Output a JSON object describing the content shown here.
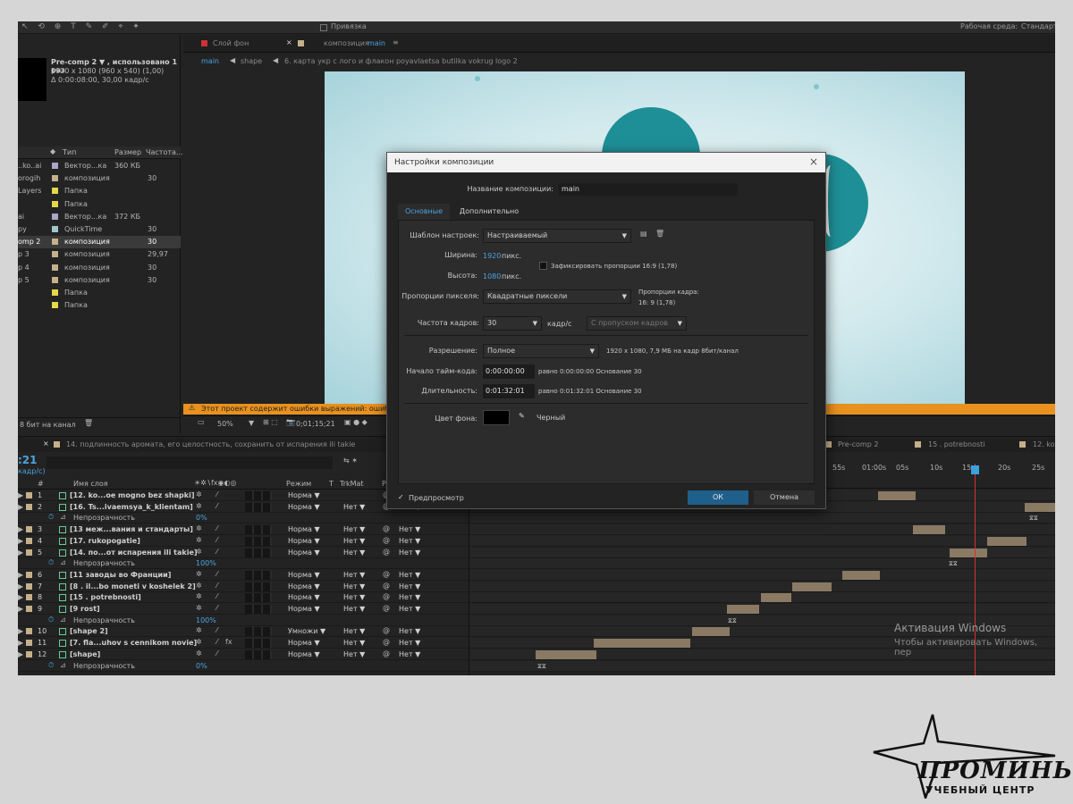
{
  "toolbar": {
    "snapping": "Привязка",
    "workspace_label": "Рабочая среда:",
    "workspace_value": "Стандарт"
  },
  "project": {
    "comp_name": "Pre-comp 2 ▼ , использовано 1 раз",
    "comp_size": "1920 x 1080  (960 x 540) (1,00)",
    "comp_duration": "Δ 0:00:08:00, 30,00 кадр/с",
    "col_type": "Тип",
    "col_size": "Размер",
    "col_rate": "Частота...",
    "items": [
      {
        "name": "..ko..ai",
        "type": "Вектор...ка",
        "size": "360 КБ",
        "rate": "",
        "color": "#a9a6c8"
      },
      {
        "name": "orogih",
        "type": "композиция",
        "size": "",
        "rate": "30",
        "color": "#c4b08a"
      },
      {
        "name": "Layers",
        "type": "Папка",
        "size": "",
        "rate": "",
        "color": "#e6d64a"
      },
      {
        "name": "",
        "type": "Папка",
        "size": "",
        "rate": "",
        "color": "#e6d64a"
      },
      {
        "name": "ai",
        "type": "Вектор...ка",
        "size": "372 КБ",
        "rate": "",
        "color": "#a9a6c8"
      },
      {
        "name": "ру",
        "type": "QuickTime",
        "size": "",
        "rate": "30",
        "color": "#9fc7c9"
      },
      {
        "name": "omp 2",
        "type": "композиция",
        "size": "",
        "rate": "30",
        "color": "#c4b08a"
      },
      {
        "name": "p 3",
        "type": "композиция",
        "size": "",
        "rate": "29,97",
        "color": "#c4b08a"
      },
      {
        "name": "p 4",
        "type": "композиция",
        "size": "",
        "rate": "30",
        "color": "#c4b08a"
      },
      {
        "name": "p 5",
        "type": "композиция",
        "size": "",
        "rate": "30",
        "color": "#c4b08a"
      },
      {
        "name": "",
        "type": "Папка",
        "size": "",
        "rate": "",
        "color": "#e6d64a"
      },
      {
        "name": "",
        "type": "Папка",
        "size": "",
        "rate": "",
        "color": "#e6d64a"
      }
    ],
    "bit_depth": "8 бит на канал"
  },
  "viewer": {
    "tab_layer": "Слой фон",
    "tab_comp": "композиция",
    "tab_comp_name": "main",
    "crumbs": [
      "main",
      "shape",
      "6. карта укр с лого и флакон poyavlaetsa butilka vokrug logo 2"
    ],
    "warning": "Этот проект содержит ошибки выражений: ошибка 1 из 23",
    "zoom": "50%",
    "timecode": "0;01;15;21"
  },
  "timeline": {
    "tabs": [
      "14. подлинность аромата, его целостность, сохранить от испарения ili takie",
      "Pre-comp 2",
      "15 . potrebnosti",
      "12. ko"
    ],
    "current_time": ":21",
    "fps_note": "кадр/с)",
    "headers": {
      "num": "#",
      "name": "Имя слоя",
      "mode": "Режим",
      "t": "T",
      "trkmat": "TrkMat",
      "parent": "Р"
    },
    "ruler": [
      "55s",
      "01:00s",
      "05s",
      "10s",
      "15s",
      "20s",
      "25s"
    ],
    "rows": [
      {
        "kind": "layer",
        "num": "1",
        "name": "[12. ko...oe mogno bez shapki]",
        "mode": "Норма",
        "trk": "",
        "parent": "Нет",
        "fx": ""
      },
      {
        "kind": "layer",
        "num": "2",
        "name": "[16. Ts...ivaemsya_k_klientam]",
        "mode": "Норма",
        "trk": "Нет",
        "parent": "Нет",
        "fx": ""
      },
      {
        "kind": "prop",
        "name": "Непрозрачность",
        "value": "0%"
      },
      {
        "kind": "layer",
        "num": "3",
        "name": "[13 меж...вания и стандарты]",
        "mode": "Норма",
        "trk": "Нет",
        "parent": "Нет",
        "fx": ""
      },
      {
        "kind": "layer",
        "num": "4",
        "name": "[17. rukopogatie]",
        "mode": "Норма",
        "trk": "Нет",
        "parent": "Нет",
        "fx": ""
      },
      {
        "kind": "layer",
        "num": "5",
        "name": "[14. по...от испарения ili takie]",
        "mode": "Норма",
        "trk": "Нет",
        "parent": "Нет",
        "fx": ""
      },
      {
        "kind": "prop",
        "name": "Непрозрачность",
        "value": "100%"
      },
      {
        "kind": "layer",
        "num": "6",
        "name": "[11 заводы во Франции]",
        "mode": "Норма",
        "trk": "Нет",
        "parent": "Нет",
        "fx": ""
      },
      {
        "kind": "layer",
        "num": "7",
        "name": "[8 . il...bo moneti v koshelek 2]",
        "mode": "Норма",
        "trk": "Нет",
        "parent": "Нет",
        "fx": ""
      },
      {
        "kind": "layer",
        "num": "8",
        "name": "[15 . potrebnosti]",
        "mode": "Норма",
        "trk": "Нет",
        "parent": "Нет",
        "fx": ""
      },
      {
        "kind": "layer",
        "num": "9",
        "name": "[9 rost]",
        "mode": "Норма",
        "trk": "Нет",
        "parent": "Нет",
        "fx": ""
      },
      {
        "kind": "prop",
        "name": "Непрозрачность",
        "value": "100%"
      },
      {
        "kind": "layer",
        "num": "10",
        "name": "[shape 2]",
        "mode": "Умножи",
        "trk": "Нет",
        "parent": "Нет",
        "fx": ""
      },
      {
        "kind": "layer",
        "num": "11",
        "name": "[7. fla...uhov s cennikom novie]",
        "mode": "Норма",
        "trk": "Нет",
        "parent": "Нет",
        "fx": "fx"
      },
      {
        "kind": "layer",
        "num": "12",
        "name": "[shape]",
        "mode": "Норма",
        "trk": "Нет",
        "parent": "Нет",
        "fx": ""
      },
      {
        "kind": "prop",
        "name": "Непрозрачность",
        "value": "0%"
      }
    ]
  },
  "dialog": {
    "title": "Настройки композиции",
    "comp_name_label": "Название композиции:",
    "comp_name_value": "main",
    "tab_basic": "Основные",
    "tab_advanced": "Дополнительно",
    "preset_label": "Шаблон настроек:",
    "preset_value": "Настраиваемый",
    "width_label": "Ширина:",
    "width_value": "1920",
    "width_unit": "пикс.",
    "height_label": "Высота:",
    "height_value": "1080",
    "height_unit": "пикс.",
    "lock_label": "Зафиксировать пропорции 16:9 (1,78)",
    "par_label": "Пропорции пикселя:",
    "par_value": "Квадратные пиксели",
    "frame_aspect_label": "Пропорции кадра:",
    "frame_aspect_value": "16: 9 (1,78)",
    "fps_label": "Частота кадров:",
    "fps_value": "30",
    "fps_unit": "кадр/с",
    "drop_value": "С пропуском кадров",
    "res_label": "Разрешение:",
    "res_value": "Полное",
    "res_info": "1920 x 1080, 7,9 МБ на кадр 8бит/канал",
    "start_label": "Начало тайм-кода:",
    "start_value": "0:00:00:00",
    "start_info": "равно 0:00:00:00  Основание 30",
    "dur_label": "Длительность:",
    "dur_value": "0:01:32:01",
    "dur_info": "равно 0:01:32:01  Основание 30",
    "bg_label": "Цвет фона:",
    "bg_name": "Черный",
    "bg_color": "#000000",
    "preview_label": "Предпросмотр",
    "ok": "ОК",
    "cancel": "Отмена"
  },
  "watermark": {
    "line1": "Активация Windows",
    "line2": "Чтобы активировать Windows, пер"
  },
  "logo": {
    "line1": "ПРОМИНЬ",
    "line2": "УЧЕБНЫЙ ЦЕНТР"
  },
  "colors": {
    "accent": "#4aa3df",
    "warning": "#e8911e",
    "playhead": "#d9302a",
    "ok_button": "#1f5f8b"
  }
}
